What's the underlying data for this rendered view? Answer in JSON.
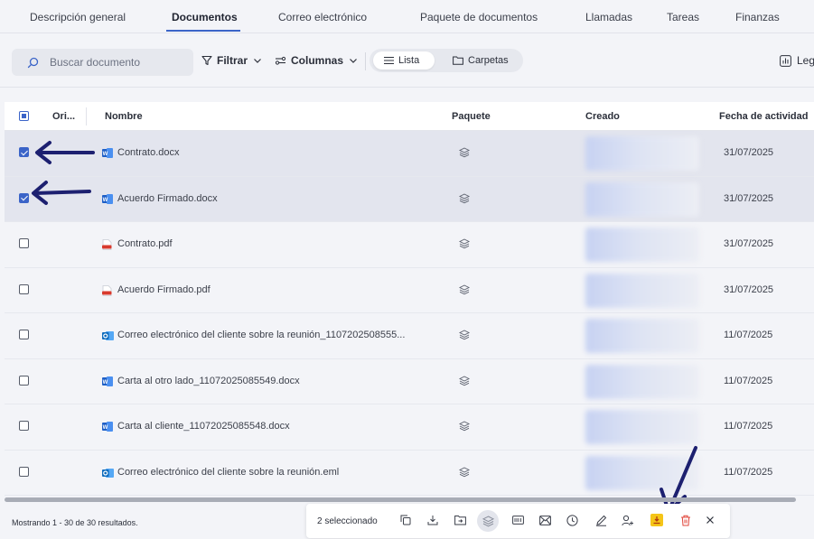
{
  "tabs": [
    {
      "label": "Descripción general"
    },
    {
      "label": "Documentos"
    },
    {
      "label": "Correo electrónico"
    },
    {
      "label": "Paquete de documentos"
    },
    {
      "label": "Llamadas"
    },
    {
      "label": "Tareas"
    },
    {
      "label": "Finanzas"
    }
  ],
  "active_tab": "Documentos",
  "toolbar": {
    "search_placeholder": "Buscar documento",
    "filter_label": "Filtrar",
    "columns_label": "Columnas",
    "view_list_label": "Lista",
    "view_folders_label": "Carpetas",
    "legend_label": "Leg"
  },
  "table": {
    "headers": {
      "origin": "Ori...",
      "name": "Nombre",
      "package": "Paquete",
      "created": "Creado",
      "activity_date": "Fecha de actividad"
    },
    "rows": [
      {
        "name": "Contrato.docx",
        "type": "word",
        "date": "31/07/2025",
        "checked": true
      },
      {
        "name": "Acuerdo Firmado.docx",
        "type": "word",
        "date": "31/07/2025",
        "checked": true
      },
      {
        "name": "Contrato.pdf",
        "type": "pdf",
        "date": "31/07/2025",
        "checked": false
      },
      {
        "name": "Acuerdo Firmado.pdf",
        "type": "pdf",
        "date": "31/07/2025",
        "checked": false
      },
      {
        "name": "Correo electrónico del cliente sobre la reunión_1107202508555...",
        "type": "outlook",
        "date": "11/07/2025",
        "checked": false
      },
      {
        "name": "Carta al otro lado_11072025085549.docx",
        "type": "word",
        "date": "11/07/2025",
        "checked": false
      },
      {
        "name": "Carta al cliente_11072025085548.docx",
        "type": "word",
        "date": "11/07/2025",
        "checked": false
      },
      {
        "name": "Correo electrónico del cliente sobre la reunión.eml",
        "type": "outlook",
        "date": "11/07/2025",
        "checked": false
      }
    ]
  },
  "footer": {
    "results_text": "Mostrando 1 - 30 de 30 resultados.",
    "selected_text": "2 seleccionado"
  },
  "colors": {
    "accent": "#3b64c8",
    "word": "#2b6fd6",
    "pdf": "#d83a2e",
    "highlight_icon": "#f5c518",
    "delete": "#e0443a",
    "annotation_arrow": "#1d2070"
  },
  "bulk_actions": [
    "copy-icon",
    "download-icon",
    "move-to-folder-icon",
    "package-icon",
    "ocr-icon",
    "email-icon",
    "history-icon",
    "edit-icon",
    "assign-user-icon",
    "download-merged-icon",
    "delete-icon",
    "close-icon"
  ]
}
